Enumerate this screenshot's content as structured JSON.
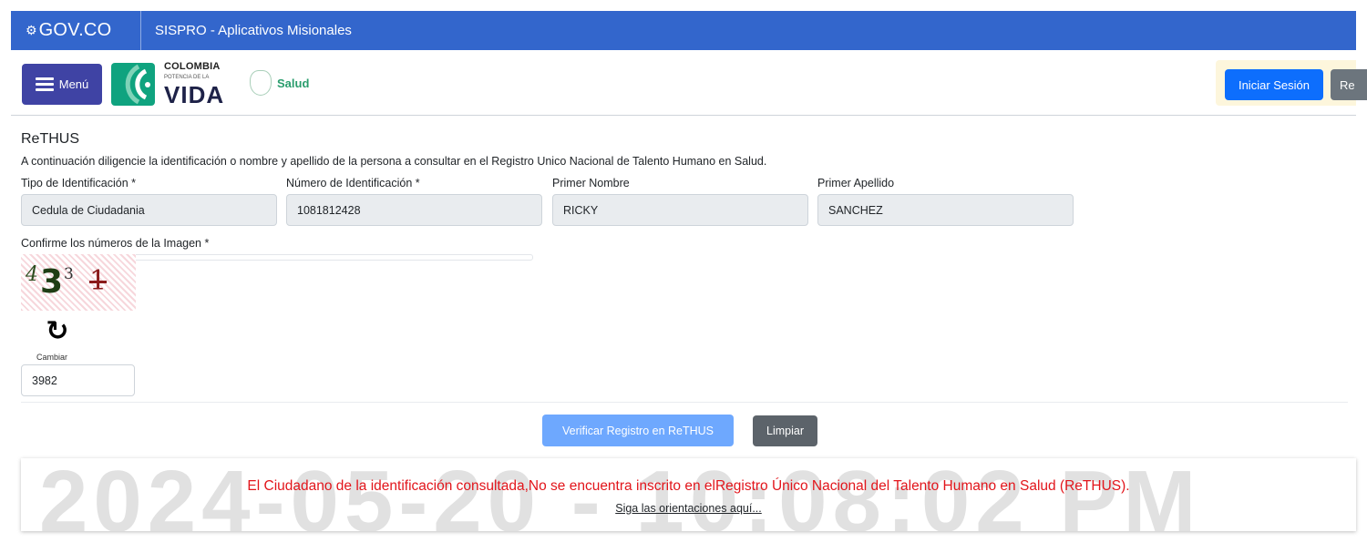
{
  "topbar": {
    "gov_label": "GOV.CO",
    "app_title": "SISPRO - Aplicativos Misionales"
  },
  "header": {
    "menu_label": "Menú",
    "logo_colombia": "COLOMBIA",
    "logo_potencia": "POTENCIA DE LA",
    "logo_vida": "VIDA",
    "salud_label": "Salud",
    "login_label": "Iniciar Sesión",
    "register_label": "Re"
  },
  "form": {
    "title": "ReTHUS",
    "instructions": "A continuación diligencie la identificación o nombre y apellido de la persona a consultar en el Registro Unico Nacional de Talento Humano en Salud.",
    "fields": [
      {
        "label": "Tipo de Identificación *",
        "value": "Cedula de Ciudadania"
      },
      {
        "label": "Número de Identificación *",
        "value": "1081812428"
      },
      {
        "label": "Primer Nombre",
        "value": "RICKY"
      },
      {
        "label": "Primer Apellido",
        "value": "SANCHEZ"
      }
    ],
    "captcha_label": "Confirme los números de la Imagen *",
    "captcha_digits": [
      "4",
      "3",
      "3",
      "1"
    ],
    "change_label": "Cambiar",
    "captcha_value": "3982",
    "verify_label": "Verificar Registro en ReTHUS",
    "clear_label": "Limpiar"
  },
  "result": {
    "message": "El Ciudadano de la identificación consultada,No se encuentra inscrito en elRegistro Único Nacional del Talento Humano en Salud (ReTHUS).",
    "link_text": "Siga las orientaciones aquí...",
    "watermark": "2024-05-20 - 10:08:02 PM"
  },
  "colors": {
    "gov_blue": "#3366cc",
    "menu_blue": "#3f43a4",
    "primary": "#0d6efd",
    "error_red": "#e2151b"
  }
}
